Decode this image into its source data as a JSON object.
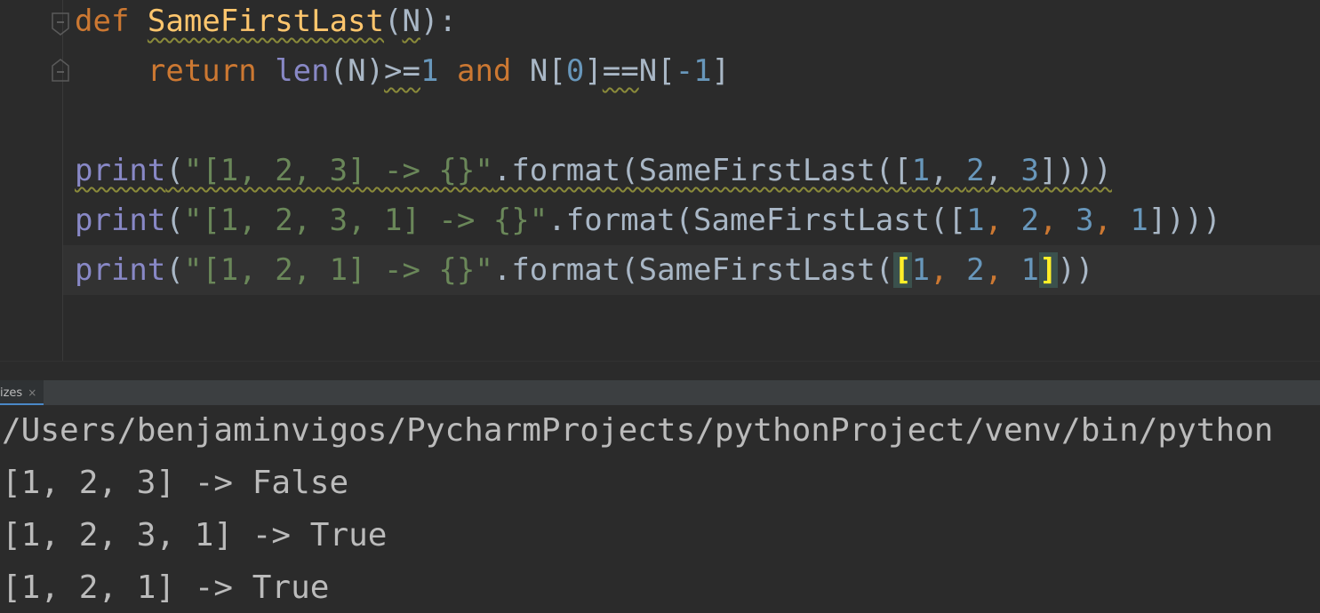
{
  "editor": {
    "lines": [
      {
        "tokens": [
          {
            "text": "def",
            "cls": "kw"
          },
          {
            "text": " ",
            "cls": "txt"
          },
          {
            "text": "SameFirstLast",
            "cls": "fn warn"
          },
          {
            "text": "(",
            "cls": "txt"
          },
          {
            "text": "N",
            "cls": "txt warn"
          },
          {
            "text": "):",
            "cls": "txt"
          }
        ]
      },
      {
        "tokens": [
          {
            "text": "    ",
            "cls": "txt"
          },
          {
            "text": "return",
            "cls": "kw"
          },
          {
            "text": " ",
            "cls": "txt"
          },
          {
            "text": "len",
            "cls": "bi"
          },
          {
            "text": "(N)",
            "cls": "txt"
          },
          {
            "text": ">=",
            "cls": "txt warn"
          },
          {
            "text": "1",
            "cls": "num"
          },
          {
            "text": " ",
            "cls": "txt"
          },
          {
            "text": "and",
            "cls": "kw"
          },
          {
            "text": " N[",
            "cls": "txt"
          },
          {
            "text": "0",
            "cls": "num"
          },
          {
            "text": "]",
            "cls": "txt"
          },
          {
            "text": "==",
            "cls": "txt warn"
          },
          {
            "text": "N[",
            "cls": "txt"
          },
          {
            "text": "-1",
            "cls": "num"
          },
          {
            "text": "]",
            "cls": "txt"
          }
        ]
      },
      {
        "tokens": []
      },
      {
        "tokens": [
          {
            "text": "print",
            "cls": "bi warn"
          },
          {
            "text": "(",
            "cls": "txt warn"
          },
          {
            "text": "\"[1, 2, 3] -> {}\"",
            "cls": "str warn"
          },
          {
            "text": ".format(SameFirstLast([",
            "cls": "txt warn"
          },
          {
            "text": "1",
            "cls": "num warn"
          },
          {
            "text": ", ",
            "cls": "txt warn"
          },
          {
            "text": "2",
            "cls": "num warn"
          },
          {
            "text": ", ",
            "cls": "txt warn"
          },
          {
            "text": "3",
            "cls": "num warn"
          },
          {
            "text": "])))",
            "cls": "txt warn"
          }
        ]
      },
      {
        "tokens": [
          {
            "text": "print",
            "cls": "bi"
          },
          {
            "text": "(",
            "cls": "txt"
          },
          {
            "text": "\"[1, 2, 3, 1] -> {}\"",
            "cls": "str"
          },
          {
            "text": ".format(SameFirstLast([",
            "cls": "txt"
          },
          {
            "text": "1",
            "cls": "num"
          },
          {
            "text": ", ",
            "cls": "kw"
          },
          {
            "text": "2",
            "cls": "num"
          },
          {
            "text": ", ",
            "cls": "kw"
          },
          {
            "text": "3",
            "cls": "num"
          },
          {
            "text": ", ",
            "cls": "kw"
          },
          {
            "text": "1",
            "cls": "num"
          },
          {
            "text": "])))",
            "cls": "txt"
          }
        ]
      },
      {
        "tokens": [
          {
            "text": "print",
            "cls": "bi"
          },
          {
            "text": "(",
            "cls": "txt"
          },
          {
            "text": "\"[1, 2, 1] -> {}\"",
            "cls": "str"
          },
          {
            "text": ".format(SameFirstLast(",
            "cls": "txt"
          },
          {
            "text": "[",
            "cls": "bracket-hl"
          },
          {
            "text": "1",
            "cls": "num"
          },
          {
            "text": ", ",
            "cls": "kw"
          },
          {
            "text": "2",
            "cls": "num"
          },
          {
            "text": ", ",
            "cls": "kw"
          },
          {
            "text": "1",
            "cls": "num"
          },
          {
            "text": "]",
            "cls": "bracket-hl"
          },
          {
            "text": "))",
            "cls": "txt"
          }
        ]
      }
    ]
  },
  "run_panel": {
    "tab_label": "izes",
    "close_glyph": "×"
  },
  "console": {
    "lines": [
      "/Users/benjaminvigos/PycharmProjects/pythonProject/venv/bin/python",
      "[1, 2, 3] -> False",
      "[1, 2, 3, 1] -> True",
      "[1, 2, 1] -> True"
    ]
  }
}
